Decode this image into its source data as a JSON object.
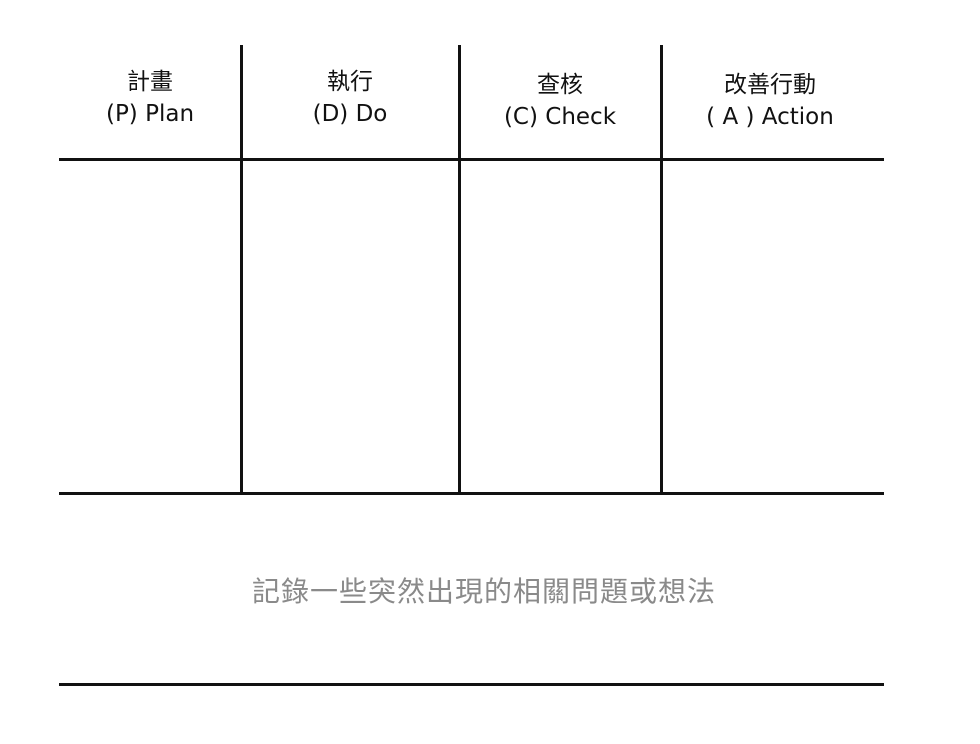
{
  "columns": [
    {
      "zh": "計畫",
      "en": "(P) Plan"
    },
    {
      "zh": "執行",
      "en": "(D) Do"
    },
    {
      "zh": "查核",
      "en": "(C) Check"
    },
    {
      "zh": "改善行動",
      "en": "( A ) Action"
    }
  ],
  "note": "記錄一些突然出現的相關問題或想法"
}
